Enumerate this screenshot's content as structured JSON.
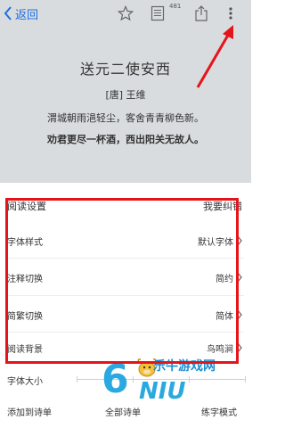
{
  "nav": {
    "back_label": "返回",
    "badge_count": "481"
  },
  "poem": {
    "title": "送元二使安西",
    "author": "[唐] 王维",
    "line1": "渭城朝雨浥轻尘，客舍青青柳色新。",
    "line2": "劝君更尽一杯酒，西出阳关无故人。"
  },
  "panel": {
    "title": "阅读设置",
    "feedback": "我要纠错",
    "rows": [
      {
        "label": "字体样式",
        "value": "默认字体"
      },
      {
        "label": "注释切换",
        "value": "简约"
      },
      {
        "label": "简繁切换",
        "value": "简体"
      },
      {
        "label": "阅读背景",
        "value": "鸟鸣涧"
      }
    ],
    "font_size_label": "字体大小"
  },
  "bottom": {
    "add_to_list": "添加到诗单",
    "all_lists": "全部诗单",
    "practice_mode": "练字模式"
  },
  "watermark": {
    "brand_cn": "乐牛游戏网",
    "logo": "6NIU"
  },
  "colors": {
    "accent": "#1e6fe0",
    "highlight": "#e5141a",
    "overlay": "#d8dcdf"
  },
  "icons": [
    "chevron-left-icon",
    "star-icon",
    "document-icon",
    "share-icon",
    "more-icon",
    "chevron-right-icon"
  ]
}
